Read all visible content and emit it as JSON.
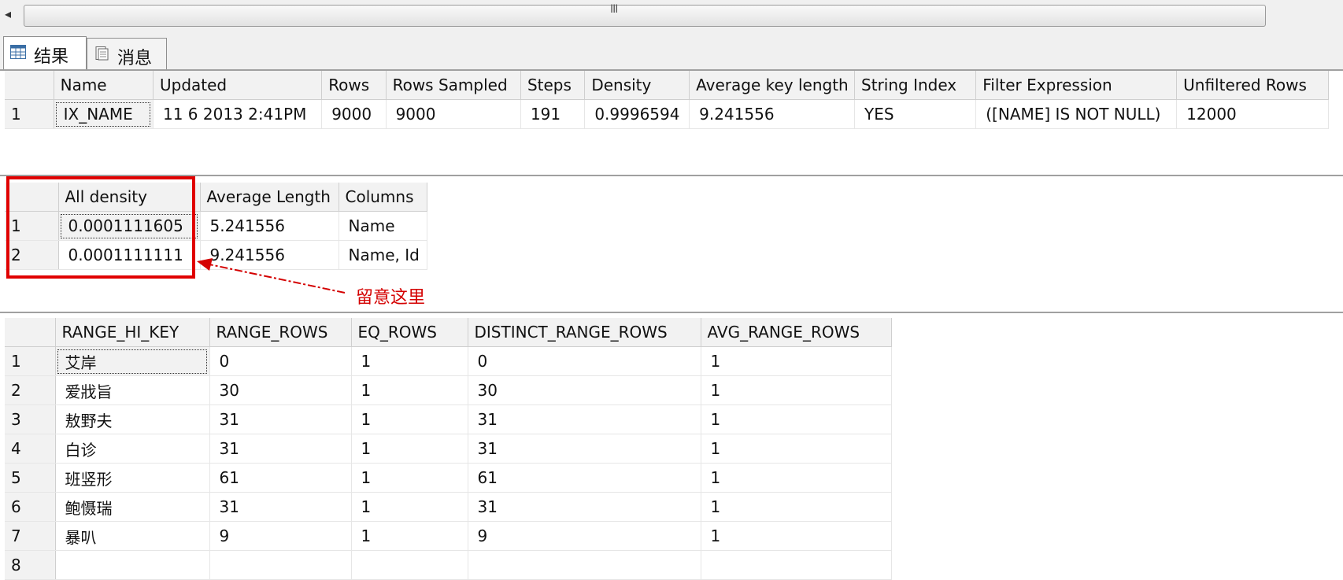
{
  "scrollbar": {
    "left_arrow": "◂",
    "grip": "III"
  },
  "tabs": [
    {
      "label": "结果",
      "active": true
    },
    {
      "label": "消息",
      "active": false
    }
  ],
  "stats_header": {
    "columns": [
      "",
      "Name",
      "Updated",
      "Rows",
      "Rows Sampled",
      "Steps",
      "Density",
      "Average key length",
      "String Index",
      "Filter Expression",
      "Unfiltered Rows"
    ],
    "rows": [
      [
        "1",
        "IX_NAME",
        "11  6 2013  2:41PM",
        "9000",
        "9000",
        "191",
        "0.9996594",
        "9.241556",
        "YES",
        "([NAME] IS NOT NULL)",
        "12000"
      ]
    ]
  },
  "density_vector": {
    "columns": [
      "",
      "All density",
      "Average Length",
      "Columns"
    ],
    "rows": [
      [
        "1",
        "0.0001111605",
        "5.241556",
        "Name"
      ],
      [
        "2",
        "0.0001111111",
        "9.241556",
        "Name, Id"
      ]
    ]
  },
  "annotation": {
    "text": "留意这里",
    "color": "#d40000"
  },
  "histogram": {
    "columns": [
      "",
      "RANGE_HI_KEY",
      "RANGE_ROWS",
      "EQ_ROWS",
      "DISTINCT_RANGE_ROWS",
      "AVG_RANGE_ROWS"
    ],
    "rows": [
      [
        "1",
        "艾岸",
        "0",
        "1",
        "0",
        "1"
      ],
      [
        "2",
        "爱戕旨",
        "30",
        "1",
        "30",
        "1"
      ],
      [
        "3",
        "敖野夫",
        "31",
        "1",
        "31",
        "1"
      ],
      [
        "4",
        "白诊",
        "31",
        "1",
        "31",
        "1"
      ],
      [
        "5",
        "班竖形",
        "61",
        "1",
        "61",
        "1"
      ],
      [
        "6",
        "鲍慑瑞",
        "31",
        "1",
        "31",
        "1"
      ],
      [
        "7",
        "暴叭",
        "9",
        "1",
        "9",
        "1"
      ],
      [
        "8",
        "",
        "",
        "",
        "",
        ""
      ]
    ]
  },
  "colors": {
    "header_bg": "#f2f2f2",
    "highlight": "#e00000"
  }
}
